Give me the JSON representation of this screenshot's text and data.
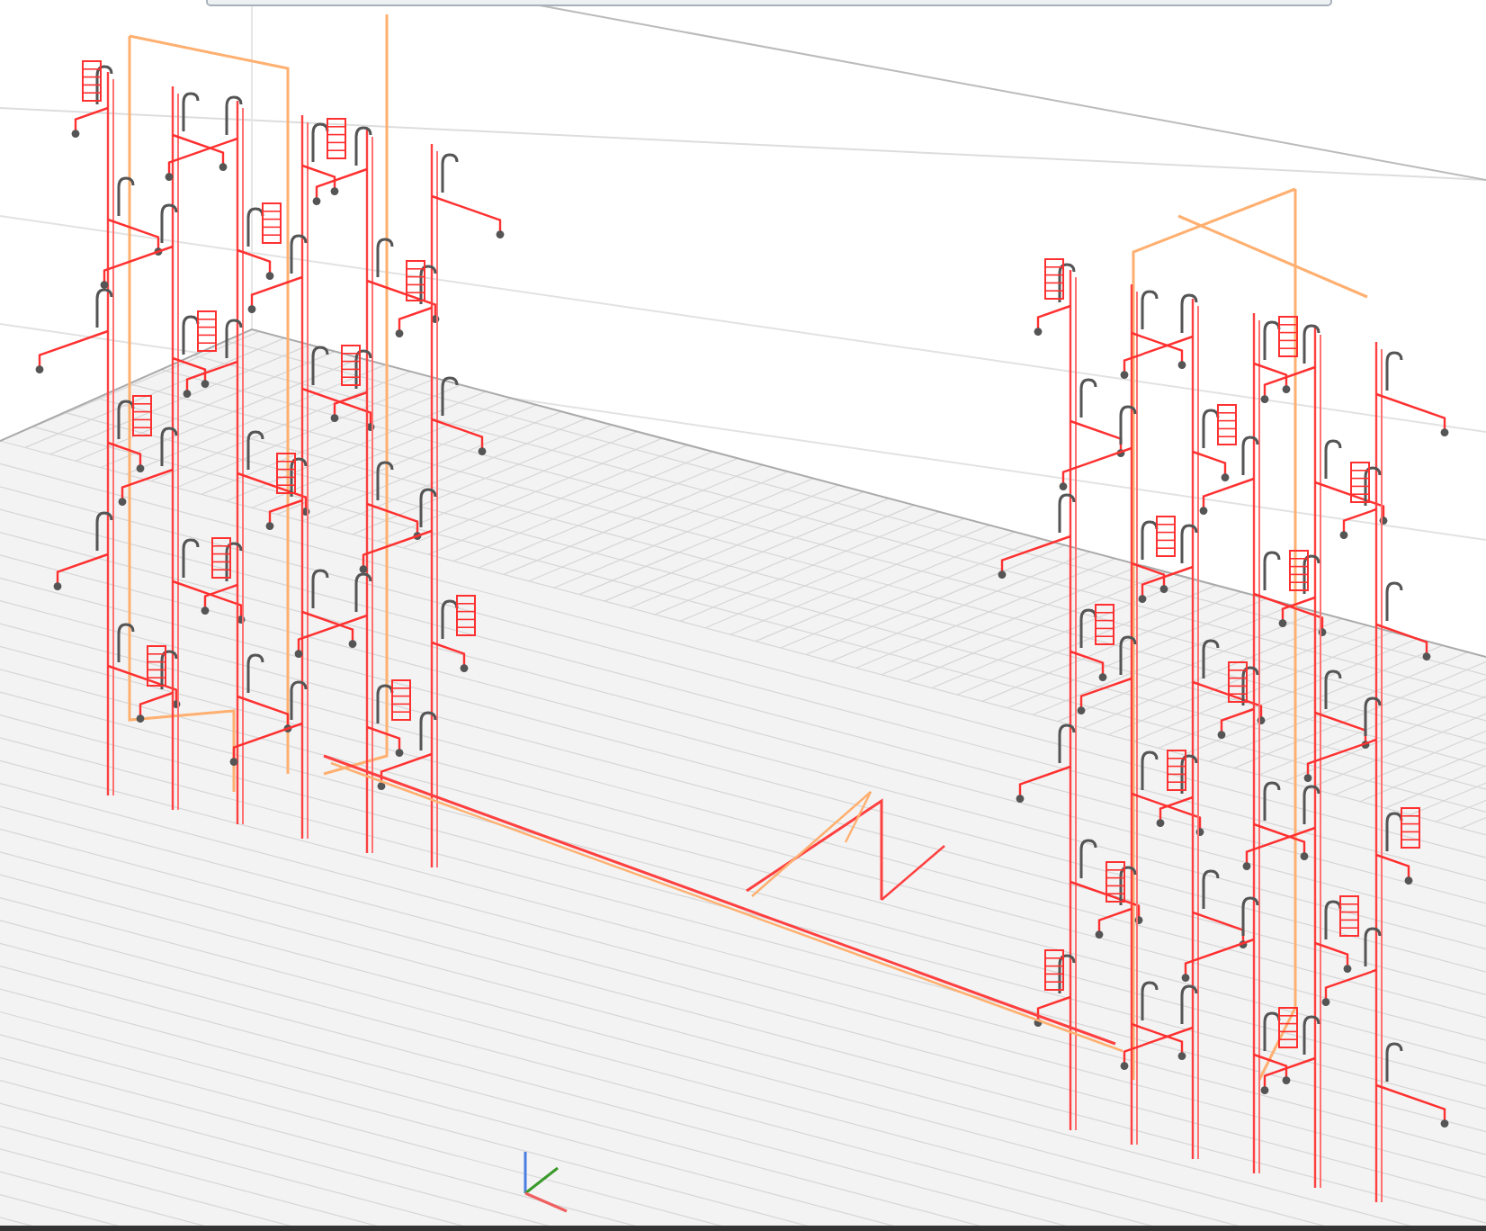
{
  "view": {
    "kind": "perspective"
  }
}
